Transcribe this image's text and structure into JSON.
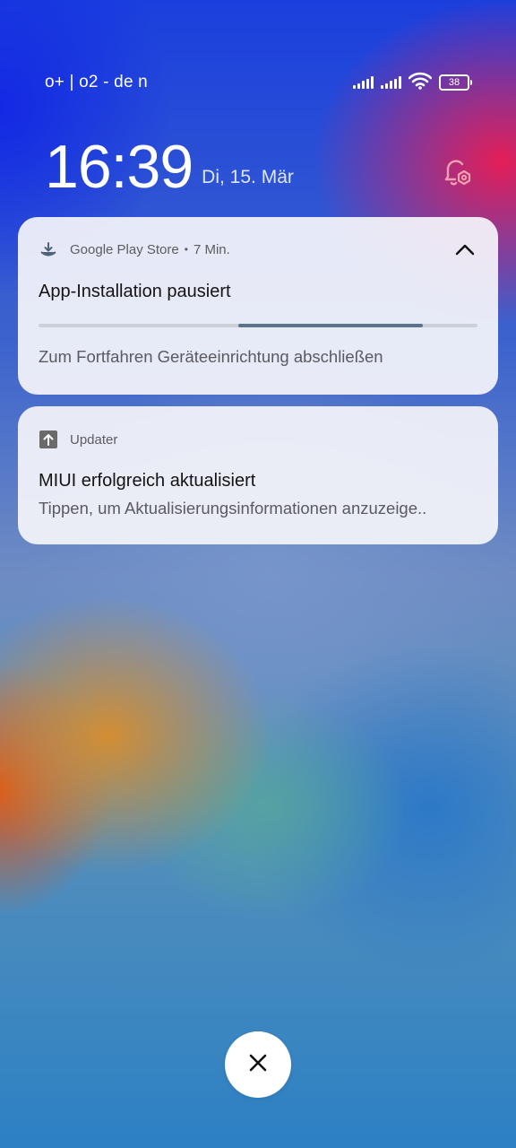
{
  "status_bar": {
    "carrier": "o+ | o2 - de     n",
    "battery": "38"
  },
  "lockscreen": {
    "time": "16:39",
    "date": "Di, 15. Mär"
  },
  "notifications": [
    {
      "app": "Google Play Store",
      "separator": "•",
      "time_ago": "7 Min.",
      "title": "App-Installation pausiert",
      "text": "Zum Fortfahren Geräteeinrichtung abschließen",
      "progress": {
        "start": 0.455,
        "end": 0.875
      },
      "icon": "download-icon",
      "expand_icon": "chevron-up-icon"
    },
    {
      "app": "Updater",
      "title": "MIUI erfolgreich aktualisiert",
      "text": "Tippen, um Aktualisierungsinformationen anzuzeige..",
      "icon": "arrow-up-icon"
    }
  ],
  "icons": {
    "bell_settings": "bell-settings-icon",
    "close": "close-icon",
    "wifi": "wifi-icon",
    "signal": "signal-icon"
  },
  "colors": {
    "card_bg": "#f4f4fa",
    "progress_track": "#c9d0d8",
    "progress_fill": "#5d7387",
    "bell_accent": "#f0a0b0"
  }
}
